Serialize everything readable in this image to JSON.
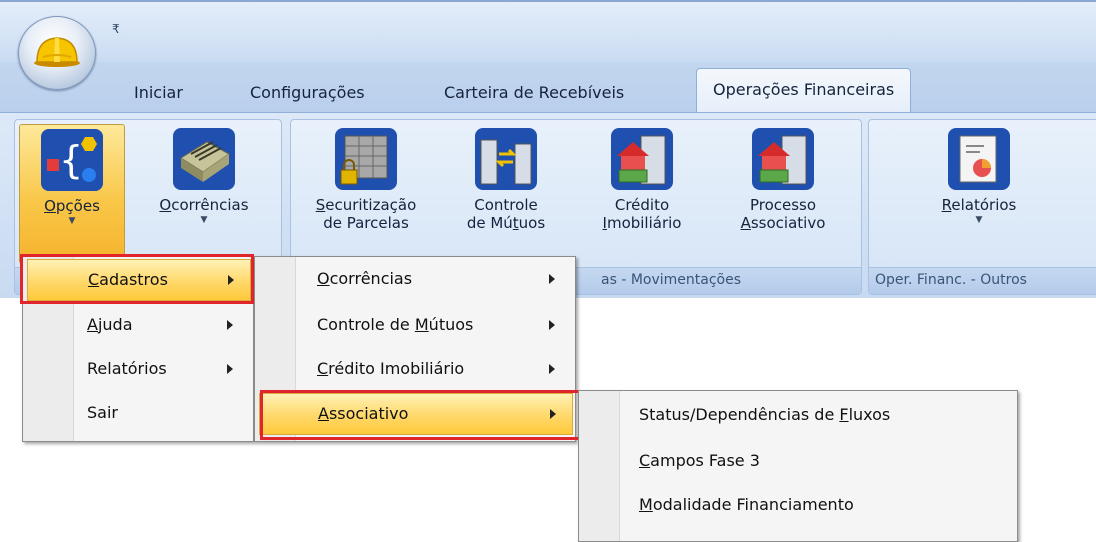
{
  "quick_access": {
    "customize_glyph": "₹"
  },
  "tabs": [
    {
      "label": "Iniciar"
    },
    {
      "label": "Configurações"
    },
    {
      "label": "Carteira de Recebíveis"
    },
    {
      "label": "Operações Financeiras",
      "active": true
    }
  ],
  "ribbon": {
    "groups": [
      {
        "label": "",
        "buttons": [
          {
            "label": "Opções",
            "underline": "O",
            "rest": "pções",
            "icon": "options-icon",
            "dropdown": true
          },
          {
            "label": "Ocorrências",
            "underline": "O",
            "rest": "corrências",
            "icon": "occurrences-icon",
            "dropdown": true
          }
        ]
      },
      {
        "label": "as - Movimentações",
        "buttons": [
          {
            "l1u": "S",
            "l1r": "ecuritização",
            "l2": "de Parcelas",
            "icon": "securitization-icon"
          },
          {
            "l1": "Controle",
            "l2a": "de Mú",
            "l2u": "t",
            "l2b": "uos",
            "icon": "loan-control-icon"
          },
          {
            "l1": "Crédito",
            "l2u": "I",
            "l2r": "mobiliário",
            "icon": "real-estate-credit-icon"
          },
          {
            "l1": "Processo",
            "l2u": "A",
            "l2r": "ssociativo",
            "icon": "associative-process-icon"
          }
        ]
      },
      {
        "label": "Oper. Financ. - Outros",
        "buttons": [
          {
            "label": "Relatórios",
            "underline": "R",
            "rest": "elatórios",
            "icon": "reports-icon",
            "dropdown": true
          }
        ]
      }
    ]
  },
  "menu1": [
    {
      "u": "C",
      "rest": "adastros",
      "submenu": true,
      "highlight": true
    },
    {
      "u": "A",
      "rest": "juda",
      "submenu": true
    },
    {
      "u": "",
      "rest": "Relatórios",
      "submenu": true
    },
    {
      "u": "",
      "rest": "Sair",
      "submenu": false
    }
  ],
  "menu2": [
    {
      "u": "O",
      "rest": "corrências",
      "submenu": true
    },
    {
      "pre": "Controle de ",
      "u": "M",
      "rest": "útuos",
      "submenu": true
    },
    {
      "u": "C",
      "rest": "rédito Imobiliário",
      "submenu": true
    },
    {
      "u": "A",
      "rest": "ssociativo",
      "submenu": true,
      "highlight": true
    }
  ],
  "menu3": [
    {
      "pre": "Status/Dependências de ",
      "u": "F",
      "rest": "luxos"
    },
    {
      "u": "C",
      "rest": "ampos Fase 3"
    },
    {
      "u": "M",
      "rest": "odalidade Financiamento"
    }
  ],
  "colors": {
    "highlight": "#ffd86a",
    "annotation_red": "#e0252b",
    "ribbon_blue": "#c8daf1"
  }
}
